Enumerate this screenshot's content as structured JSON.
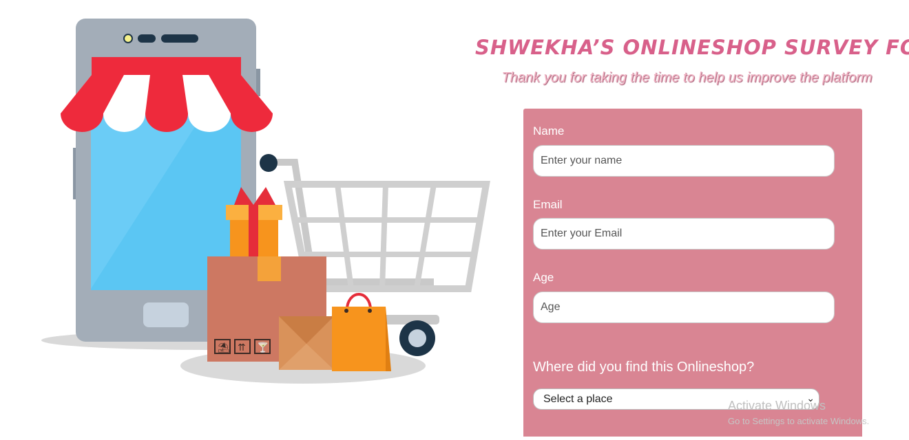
{
  "header": {
    "title": "SHWEKHA’S ONLINESHOP SURVEY FORM",
    "subtitle": "Thank you for taking the time to help us improve the platform"
  },
  "illustration": {
    "description_icon": "phone-shop-cart-icon",
    "box_symbols": [
      "⛱",
      "⇈",
      "🍸"
    ]
  },
  "form": {
    "name": {
      "label": "Name",
      "placeholder": "Enter your name"
    },
    "email": {
      "label": "Email",
      "placeholder": "Enter your Email"
    },
    "age": {
      "label": "Age",
      "placeholder": "Age"
    },
    "source": {
      "question": "Where did you find this Onlineshop?",
      "selected": "Select a place"
    }
  },
  "watermark": {
    "title": "Activate Windows",
    "subtitle": "Go to Settings to activate Windows."
  },
  "colors": {
    "title": "#d8608a",
    "card": "#d98593",
    "awning_red": "#ee2a3c"
  }
}
